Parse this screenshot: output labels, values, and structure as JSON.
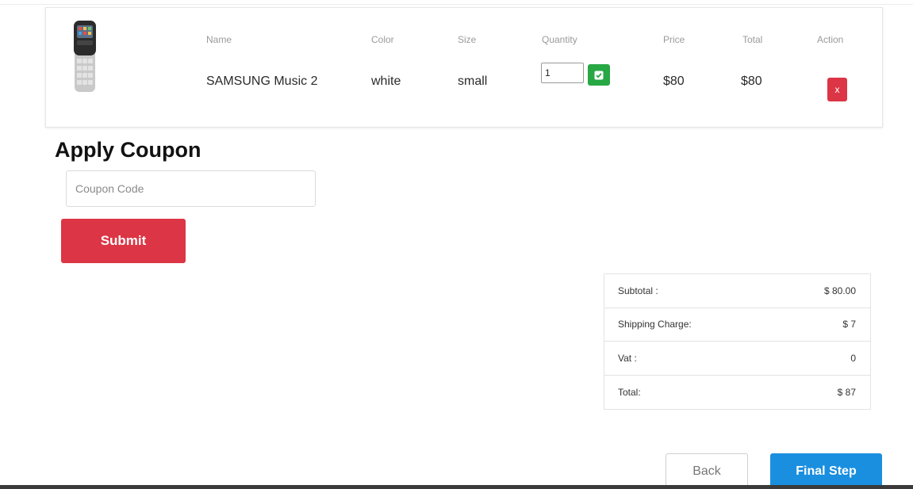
{
  "cart": {
    "headers": {
      "name": "Name",
      "color": "Color",
      "size": "Size",
      "quantity": "Quantity",
      "price": "Price",
      "total": "Total",
      "action": "Action"
    },
    "item": {
      "image_icon": "phone-image",
      "name": "SAMSUNG Music 2",
      "color": "white",
      "size": "small",
      "quantity": "1",
      "price": "$80",
      "total": "$80",
      "remove_label": "x"
    }
  },
  "coupon": {
    "title": "Apply Coupon",
    "placeholder": "Coupon Code",
    "submit_label": "Submit"
  },
  "summary": {
    "subtotal_label": "Subtotal :",
    "subtotal_value": "$ 80.00",
    "shipping_label": "Shipping Charge:",
    "shipping_value": "$ 7",
    "vat_label": "Vat :",
    "vat_value": "0",
    "total_label": "Total:",
    "total_value": "$ 87"
  },
  "footer": {
    "back_label": "Back",
    "final_label": "Final Step"
  },
  "colors": {
    "danger": "#dc3545",
    "success": "#28a745",
    "primary": "#1a8fe0"
  }
}
